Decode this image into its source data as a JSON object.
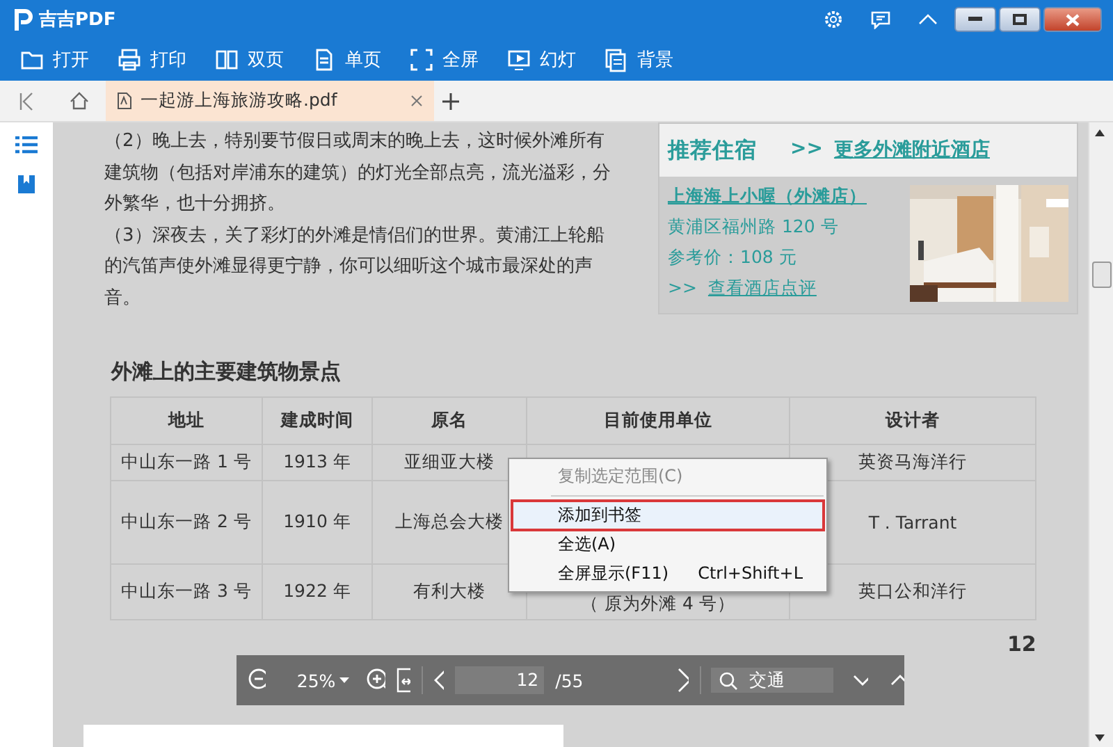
{
  "app": {
    "name": "吉吉PDF"
  },
  "toolbar": [
    {
      "label": "打开"
    },
    {
      "label": "打印"
    },
    {
      "label": "双页"
    },
    {
      "label": "单页"
    },
    {
      "label": "全屏"
    },
    {
      "label": "幻灯"
    },
    {
      "label": "背景"
    }
  ],
  "tabs": [
    {
      "title": "一起游上海旅游攻略.pdf",
      "selected": true
    }
  ],
  "document": {
    "paragraphs": [
      "（2）晚上去，特别要节假日或周末的晚上去，这时候外滩所有建筑物（包括对岸浦东的建筑）的灯光全部点亮，流光溢彩，分外繁华，也十分拥挤。",
      "（3）深夜去，关了彩灯的外滩是情侣们的世界。黄浦江上轮船的汽笛声使外滩显得更宁静，你可以细听这个城市最深处的声音。"
    ],
    "hotel": {
      "heading": "推荐住宿",
      "more_prefix": ">>",
      "more_link": "更多外滩附近酒店",
      "name": "上海海上小喔（外滩店）",
      "address": "黄浦区福州路 120 号",
      "price": "参考价：108 元",
      "review_prefix": ">>",
      "review_link": "查看酒店点评"
    },
    "table": {
      "title": "外滩上的主要建筑物景点",
      "columns": [
        "地址",
        "建成时间",
        "原名",
        "目前使用单位",
        "设计者"
      ],
      "rows": [
        [
          "中山东一路 1 号",
          "1913 年",
          "亚细亚大楼",
          null,
          "英资马海洋行"
        ],
        [
          "中山东一路 2 号",
          "1910 年",
          "上海总会大楼",
          null,
          "T . Tarrant"
        ],
        [
          "中山东一路 3 号",
          "1922 年",
          "有利大楼",
          "（ 原为外滩 4 号）",
          "英口公和洋行"
        ]
      ]
    },
    "page_number": "12"
  },
  "context_menu": [
    {
      "kind": "item",
      "label": "复制选定范围(C)",
      "disabled": true,
      "selected": false
    },
    {
      "kind": "separator"
    },
    {
      "kind": "item",
      "label": "添加到书签",
      "disabled": false,
      "selected": true
    },
    {
      "kind": "item",
      "label": "全选(A)",
      "disabled": false,
      "selected": false
    },
    {
      "kind": "item",
      "label": "全屏显示(F11)",
      "shortcut": "Ctrl+Shift+L",
      "disabled": false,
      "selected": false
    }
  ],
  "viewer_bar": {
    "zoom": "25%",
    "page": "12",
    "total": "/55",
    "search": "交通"
  }
}
